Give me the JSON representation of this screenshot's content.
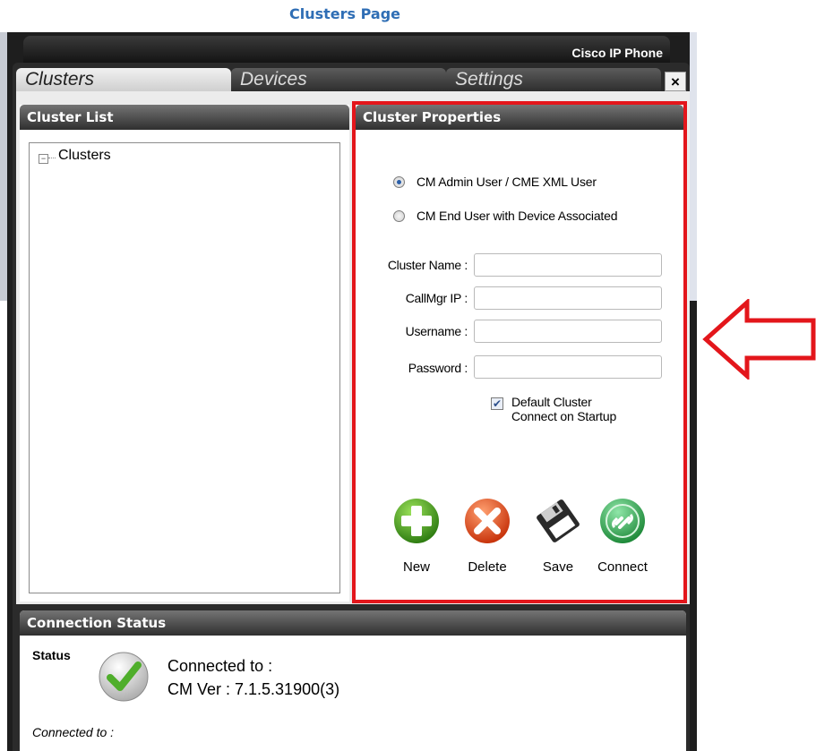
{
  "doc_title": "Clusters Page",
  "window": {
    "title": "Cisco IP Phone",
    "close_label": "×"
  },
  "tabs": [
    {
      "label": "Clusters"
    },
    {
      "label": "Devices"
    },
    {
      "label": "Settings"
    }
  ],
  "cluster_list": {
    "header": "Cluster List",
    "tree": {
      "toggle": "−",
      "root": "Clusters"
    }
  },
  "cluster_properties": {
    "header": "Cluster Properties",
    "options": [
      {
        "label": "CM Admin User / CME XML User",
        "selected": true
      },
      {
        "label": "CM End User with Device Associated",
        "selected": false
      }
    ],
    "fields": {
      "cluster_name": {
        "label": "Cluster Name :",
        "value": ""
      },
      "callmgr_ip": {
        "label": "CallMgr IP :",
        "value": ""
      },
      "username": {
        "label": "Username :",
        "value": ""
      },
      "password": {
        "label": "Password :",
        "value": ""
      }
    },
    "default_cluster": {
      "checked": true,
      "check_glyph": "✔",
      "line1": "Default Cluster",
      "line2": "Connect on Startup"
    },
    "actions": [
      {
        "label": "New",
        "icon": "plus-icon"
      },
      {
        "label": "Delete",
        "icon": "x-icon"
      },
      {
        "label": "Save",
        "icon": "floppy-disk-icon"
      },
      {
        "label": "Connect",
        "icon": "connect-icon"
      }
    ]
  },
  "connection_status": {
    "header": "Connection Status",
    "status_label": "Status",
    "connected_to": "Connected to :",
    "cm_version": "CM Ver : 7.1.5.31900(3)",
    "footer": "Connected to :"
  },
  "colors": {
    "highlight": "#e3161b",
    "accent_text": "#2f6eb5"
  }
}
